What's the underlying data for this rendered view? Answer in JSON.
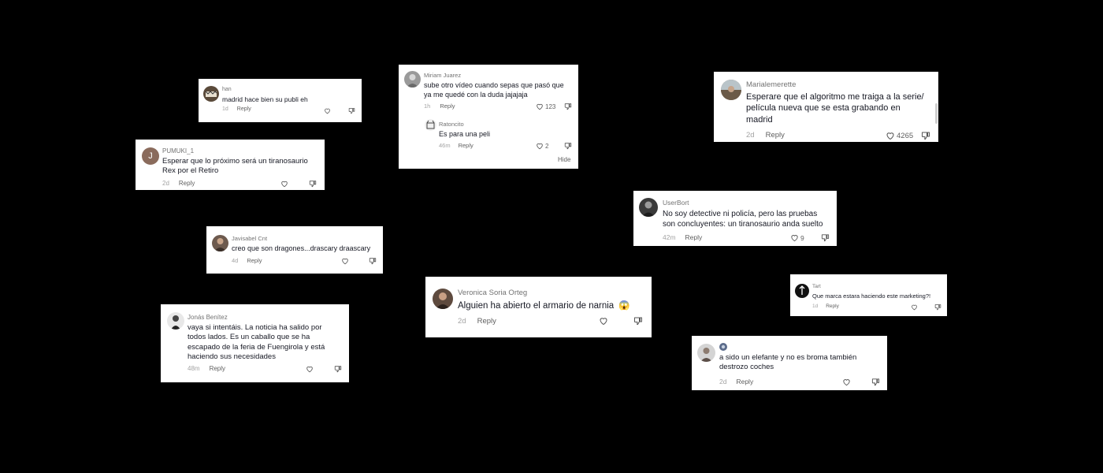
{
  "comments": {
    "han": {
      "user": "han",
      "text": "madrid hace bien su publi eh",
      "time": "1d",
      "reply": "Reply"
    },
    "pumuki": {
      "user": "PUMUKI_1",
      "avatar_letter": "J",
      "text_l1": "Esperar que lo próximo será un tiranosaurio",
      "text_l2": "Rex por el Retiro",
      "time": "2d",
      "reply": "Reply"
    },
    "javisabel": {
      "user": "Javisabel Cnt",
      "text": "creo que son dragones...drascary draascary",
      "time": "4d",
      "reply": "Reply"
    },
    "jonas": {
      "user": "Jonás Benítez",
      "text_l1": "vaya si intentáis. La noticia ha salido por",
      "text_l2": "todos lados. Es un caballo que se ha",
      "text_l3": "escapado de la feria de Fuengirola y está",
      "text_l4": "haciendo sus necesidades",
      "time": "48m",
      "reply": "Reply"
    },
    "miriam": {
      "user": "Miriam Juarez",
      "text_l1": "sube otro vídeo cuando sepas que pasó que",
      "text_l2": "ya me quedé con la duda jajajaja",
      "time": "1h",
      "reply": "Reply",
      "likes": "123"
    },
    "ratoncito": {
      "user": "Ratoncito",
      "text": "Es para una peli",
      "time": "46m",
      "reply": "Reply",
      "likes": "2",
      "hide": "Hide"
    },
    "veronica": {
      "user": "Veronica Soria Orteg",
      "text": "Alguien ha abierto el armario de narnia",
      "emoji": "😱",
      "time": "2d",
      "reply": "Reply"
    },
    "marialemerette": {
      "user": "Marialemerette",
      "text_l1": "Esperare que el algoritmo me traiga a la serie/",
      "text_l2": "película nueva que se esta grabando en",
      "text_l3": "madrid",
      "time": "2d",
      "reply": "Reply",
      "likes": "4265"
    },
    "userbort": {
      "user": "UserBort",
      "text_l1": "No soy detective ni policía, pero las pruebas",
      "text_l2": "son concluyentes: un tiranosaurio anda suelto",
      "time": "42m",
      "reply": "Reply",
      "likes": "9"
    },
    "tart": {
      "user": "Tart",
      "text": "Que marca estara haciendo este marketing?!",
      "time": "1d",
      "reply": "Reply"
    },
    "elefante": {
      "user": "",
      "text_l1": "a sido un elefante y no es broma también",
      "text_l2": "destrozo coches",
      "time": "2d",
      "reply": "Reply"
    }
  },
  "colors": {
    "background": "#000000",
    "card": "#ffffff",
    "text": "#161823",
    "muted": "#8a8a8a"
  },
  "icons": [
    "heart-icon",
    "dislike-icon",
    "avatar"
  ]
}
